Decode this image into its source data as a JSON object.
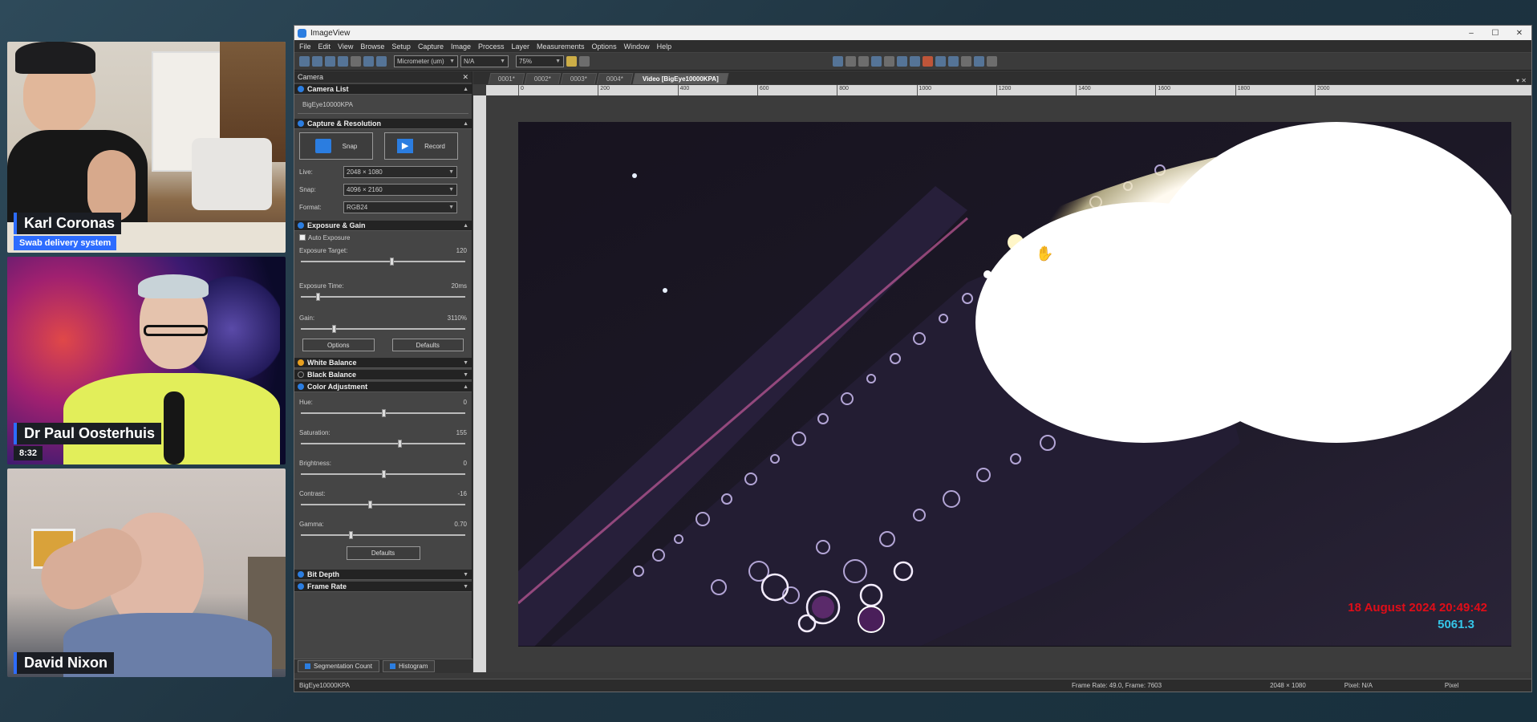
{
  "participants": [
    {
      "name": "Karl Coronas",
      "subtitle": "Swab delivery system"
    },
    {
      "name": "Dr Paul Oosterhuis",
      "subtitle": "8:32"
    },
    {
      "name": "David Nixon",
      "subtitle": ""
    }
  ],
  "app": {
    "title": "ImageView",
    "window_controls": [
      "–",
      "☐",
      "✕"
    ],
    "menu": [
      "File",
      "Edit",
      "View",
      "Browse",
      "Setup",
      "Capture",
      "Image",
      "Process",
      "Layer",
      "Measurements",
      "Options",
      "Window",
      "Help"
    ],
    "toolbar": {
      "unit": "Micrometer (um)",
      "unit2": "N/A",
      "zoom": "75%"
    }
  },
  "camera_panel": {
    "tab": "Camera",
    "camera_list": {
      "header": "Camera List",
      "device": "BigEye10000KPA"
    },
    "capture_resolution": {
      "header": "Capture & Resolution",
      "snap_label": "Snap",
      "record_label": "Record",
      "live_label": "Live:",
      "live_value": "2048 × 1080",
      "snap_res_label": "Snap:",
      "snap_res_value": "4096 × 2160",
      "format_label": "Format:",
      "format_value": "RGB24"
    },
    "exposure_gain": {
      "header": "Exposure & Gain",
      "auto_exposure": "Auto Exposure",
      "exposure_target_label": "Exposure Target:",
      "exposure_target_value": "120",
      "exposure_target_level": 0.55,
      "exposure_time_label": "Exposure Time:",
      "exposure_time_value": "20ms",
      "exposure_time_level": 0.1,
      "gain_label": "Gain:",
      "gain_value": "3110%",
      "gain_level": 0.2,
      "options_label": "Options",
      "defaults_label": "Defaults"
    },
    "white_balance": "White Balance",
    "black_balance": "Black Balance",
    "color_adjustment": {
      "header": "Color Adjustment",
      "hue_label": "Hue:",
      "hue_value": "0",
      "hue_level": 0.5,
      "saturation_label": "Saturation:",
      "saturation_value": "155",
      "saturation_level": 0.6,
      "brightness_label": "Brightness:",
      "brightness_value": "0",
      "brightness_level": 0.5,
      "contrast_label": "Contrast:",
      "contrast_value": "-16",
      "contrast_level": 0.42,
      "gamma_label": "Gamma:",
      "gamma_value": "0.70",
      "gamma_level": 0.3,
      "defaults_label": "Defaults"
    },
    "bit_depth": "Bit Depth",
    "frame_rate": "Frame Rate"
  },
  "document_tabs": [
    "0001*",
    "0002*",
    "0003*",
    "0004*",
    "Video [BigEye10000KPA]"
  ],
  "active_tab_index": 4,
  "ruler_labels": [
    "0",
    "200",
    "400",
    "600",
    "800",
    "1000",
    "1200",
    "1400",
    "1600",
    "1800",
    "2000"
  ],
  "viewer_overlay": {
    "date": "18 August 2024 20:49:42",
    "number": "5061.3"
  },
  "bottom_tabs": [
    "Segmentation Count",
    "Histogram"
  ],
  "statusbar": {
    "device": "BigEye10000KPA",
    "frame_info": "Frame Rate: 49.0, Frame: 7603",
    "resolution": "2048 × 1080",
    "pixel": "Pixel: N/A",
    "extra": "Pixel"
  },
  "colors": {
    "accent": "#2d6cff",
    "overlay_date": "#e00d18",
    "overlay_number": "#35c6e8"
  }
}
